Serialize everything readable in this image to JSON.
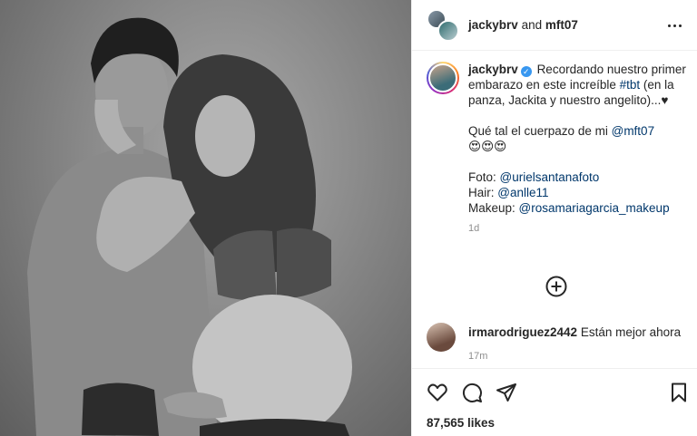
{
  "post": {
    "header": {
      "user1": "jackybrv",
      "and_text": "and",
      "user2": "mft07"
    },
    "caption": {
      "username": "jackybrv",
      "verified_mark": "✓",
      "line1": "Recordando nuestro primer embarazo en este increíble",
      "hashtag": "#tbt",
      "line2": "(en la panza, Jackita y nuestro angelito)...♥",
      "line3": "Qué tal el cuerpazo de mi",
      "mention_mft": "@mft07",
      "emojis": "😍😍😍",
      "foto_label": "Foto:",
      "foto_mention": "@urielsantanafoto",
      "hair_label": "Hair:",
      "hair_mention": "@anlle11",
      "makeup_label": "Makeup:",
      "makeup_mention": "@rosamariagarcia_makeup",
      "time": "1d"
    },
    "comment": {
      "username": "irmarodriguez2442",
      "text": "Están mejor ahora",
      "time": "17m"
    },
    "likes": "87,565 likes"
  },
  "icons": {
    "more": "more-options-icon",
    "load_more": "add-circle-icon",
    "like": "heart-icon",
    "comment": "comment-icon",
    "share": "send-icon",
    "save": "bookmark-icon"
  }
}
